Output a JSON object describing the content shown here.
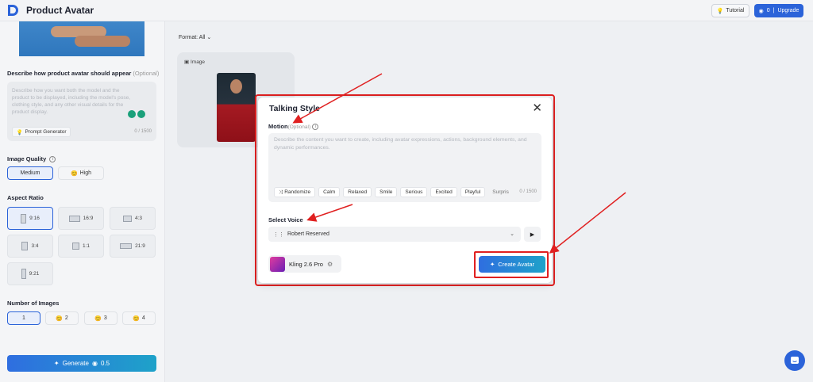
{
  "header": {
    "title": "Product Avatar",
    "tutorial_label": "Tutorial",
    "credits": "0",
    "upgrade_label": "Upgrade"
  },
  "left": {
    "describe_label": "Describe how product avatar should appear",
    "describe_optional": "(Optional)",
    "describe_placeholder": "Describe how you want both the model and the product to be displayed, including the model's pose, clothing style, and any other visual details for the product display.",
    "prompt_generator": "Prompt Generator",
    "describe_count": "0 / 1500",
    "image_quality_label": "Image Quality",
    "quality": [
      "Medium",
      "High"
    ],
    "aspect_ratio_label": "Aspect Ratio",
    "ratios": [
      "9:16",
      "16:9",
      "4:3",
      "3:4",
      "1:1",
      "21:9",
      "9:21"
    ],
    "num_images_label": "Number of Images",
    "num_images": [
      "1",
      "2",
      "3",
      "4"
    ],
    "generate_label": "Generate",
    "generate_cost": "0.5"
  },
  "main": {
    "format_label": "Format: All",
    "card_label": "Image"
  },
  "modal": {
    "title": "Talking Style",
    "motion_label": "Motion",
    "motion_optional": "(Optional)",
    "motion_placeholder": "Describe the content you want to create, including avatar expressions, actions, background elements, and dynamic performances.",
    "chips": [
      "Randomize",
      "Calm",
      "Relaxed",
      "Smile",
      "Serious",
      "Excited",
      "Playful",
      "Surpris"
    ],
    "motion_count": "0 / 1500",
    "select_voice_label": "Select Voice",
    "voice_value": "Robert Reserved",
    "model_name": "Kling 2.6 Pro",
    "create_label": "Create Avatar"
  },
  "colors": {
    "accent": "#2b63d9",
    "annotation": "#e02020"
  }
}
